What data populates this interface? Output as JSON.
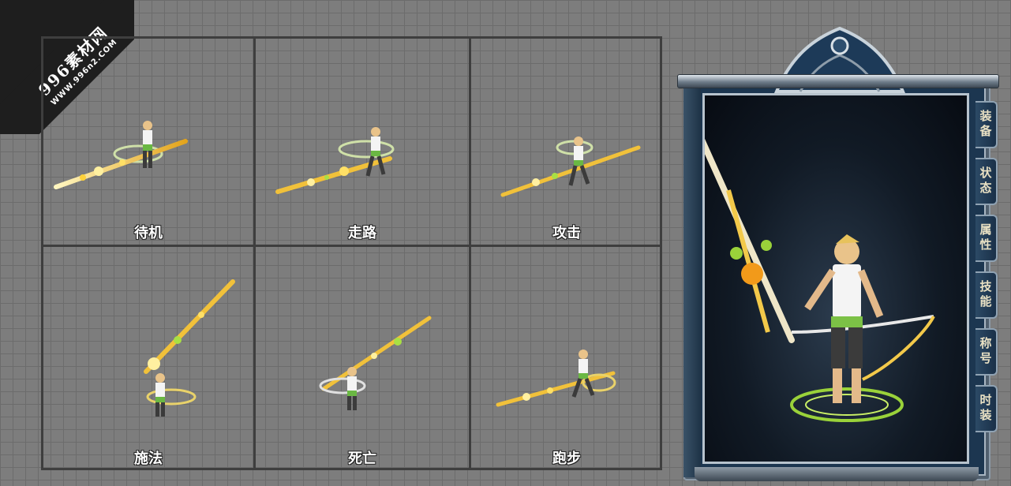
{
  "watermark": {
    "site_name": "996素材网",
    "url": "WWW.996n2.COM"
  },
  "animations": [
    {
      "label": "待机"
    },
    {
      "label": "走路"
    },
    {
      "label": "攻击"
    },
    {
      "label": "施法"
    },
    {
      "label": "死亡"
    },
    {
      "label": "跑步"
    }
  ],
  "character_panel": {
    "tabs": [
      "装备",
      "状态",
      "属性",
      "技能",
      "称号",
      "时装"
    ]
  },
  "colors": {
    "background": "#7d7d7d",
    "grid_line": "#6c6c6c",
    "cell_border": "#3e3e3e",
    "weapon_glow": "#f3c94a",
    "effect_green": "#9ad23a",
    "panel_blue": "#1c3650"
  }
}
